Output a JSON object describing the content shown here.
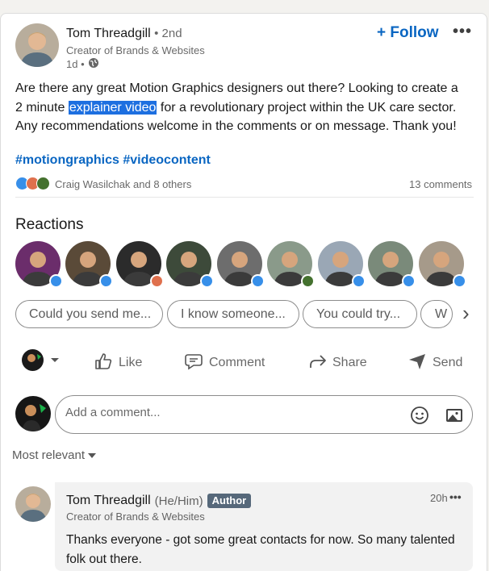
{
  "post": {
    "author_name": "Tom Threadgill",
    "degree": "• 2nd",
    "headline": "Creator of Brands & Websites",
    "time": "1d •",
    "follow_label": "+ Follow",
    "more_label": "•••",
    "body_before": "Are there any great Motion Graphics designers out there? Looking to create a 2 minute ",
    "body_highlight": "explainer video",
    "body_after": " for a revolutionary project within the UK care sector. Any recommendations welcome in the comments or on message. Thank you!",
    "hashtags": "#motiongraphics #videocontent",
    "reactors_text": "Craig Wasilchak and 8 others",
    "comments_count": "13 comments"
  },
  "reactions": {
    "title": "Reactions",
    "avatars": [
      {
        "icon": "like",
        "bg": "#6b2d6b"
      },
      {
        "icon": "like",
        "bg": "#5a4a38"
      },
      {
        "icon": "love",
        "bg": "#2b2b2b"
      },
      {
        "icon": "like",
        "bg": "#3d4a3a"
      },
      {
        "icon": "like",
        "bg": "#6d6d6d"
      },
      {
        "icon": "celebrate",
        "bg": "#8a9a8a"
      },
      {
        "icon": "like",
        "bg": "#9aa7b5"
      },
      {
        "icon": "like",
        "bg": "#7a8a7a"
      },
      {
        "icon": "like",
        "bg": "#a69a8a"
      }
    ]
  },
  "suggestions": {
    "chips": [
      "Could you send me...",
      "I know someone...",
      "You could try...",
      "W"
    ],
    "next_label": "›"
  },
  "actions": {
    "like": "Like",
    "comment": "Comment",
    "share": "Share",
    "send": "Send"
  },
  "comment_input": {
    "placeholder": "Add a comment..."
  },
  "sort": {
    "label": "Most relevant"
  },
  "reply": {
    "author_name": "Tom Threadgill",
    "pronouns": "(He/Him)",
    "badge": "Author",
    "headline": "Creator of Brands & Websites",
    "time": "20h",
    "more_label": "•••",
    "text": "Thanks everyone - got some great contacts for now. So many talented folk out there."
  },
  "colors": {
    "brand_blue": "#0a66c2",
    "highlight": "#1d6fe0",
    "like": "#378fe9",
    "love": "#df704d",
    "celebrate": "#44712e"
  }
}
